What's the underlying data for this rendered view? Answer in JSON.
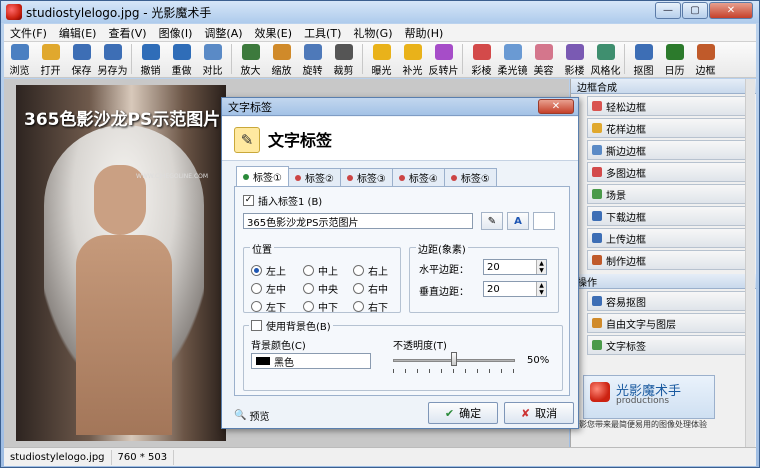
{
  "window": {
    "title": "studiostylelogo.jpg - 光影魔术手",
    "controls": {
      "minimize": "—",
      "maximize": "▢",
      "close": "✕"
    }
  },
  "menu": [
    "文件(F)",
    "编辑(E)",
    "查看(V)",
    "图像(I)",
    "调整(A)",
    "效果(E)",
    "工具(T)",
    "礼物(G)",
    "帮助(H)"
  ],
  "toolbar": [
    {
      "label": "浏览",
      "icon": "browse-icon",
      "color": "#4a7fc1"
    },
    {
      "label": "打开",
      "icon": "open-folder-icon",
      "color": "#e0a82e"
    },
    {
      "label": "保存",
      "icon": "save-icon",
      "color": "#3d6eb5"
    },
    {
      "label": "另存为",
      "icon": "save-as-icon",
      "color": "#3d6eb5"
    },
    {
      "label": "撤销",
      "icon": "undo-icon",
      "color": "#2f6db8"
    },
    {
      "label": "重做",
      "icon": "redo-icon",
      "color": "#2f6db8"
    },
    {
      "label": "对比",
      "icon": "compare-icon",
      "color": "#5a8ac6"
    },
    {
      "label": "放大",
      "icon": "zoom-in-icon",
      "color": "#3d7a3d"
    },
    {
      "label": "缩放",
      "icon": "resize-icon",
      "color": "#d08a2a"
    },
    {
      "label": "旋转",
      "icon": "rotate-icon",
      "color": "#4e79b9"
    },
    {
      "label": "裁剪",
      "icon": "crop-icon",
      "color": "#555555"
    },
    {
      "label": "曝光",
      "icon": "exposure-icon",
      "color": "#e9b21a"
    },
    {
      "label": "补光",
      "icon": "fill-light-icon",
      "color": "#e9b21a"
    },
    {
      "label": "反转片",
      "icon": "reversal-film-icon",
      "color": "#a64dc8"
    },
    {
      "label": "彩棱",
      "icon": "color-prism-icon",
      "color": "#d34a4a"
    },
    {
      "label": "柔光镜",
      "icon": "soft-focus-icon",
      "color": "#6a9ad3"
    },
    {
      "label": "美容",
      "icon": "beauty-icon",
      "color": "#d4768c"
    },
    {
      "label": "影楼",
      "icon": "studio-icon",
      "color": "#7a5ab3"
    },
    {
      "label": "风格化",
      "icon": "stylize-icon",
      "color": "#3f8f6f"
    },
    {
      "label": "抠图",
      "icon": "cutout-icon",
      "color": "#3d6eb5"
    },
    {
      "label": "日历",
      "icon": "calendar-icon",
      "color": "#2c7a2c"
    },
    {
      "label": "边框",
      "icon": "border-icon",
      "color": "#c05a2a"
    }
  ],
  "photo": {
    "overlay_text": "365色影沙龙PS示范图片",
    "watermark": "WWW.CJHEGOLINE.COM"
  },
  "right_panel": {
    "section1": "边框合成",
    "items1": [
      "轻松边框",
      "花样边框",
      "撕边边框",
      "多图边框",
      "场景",
      "下载边框",
      "上传边框",
      "制作边框"
    ],
    "section2": "操作",
    "items2": [
      "容易抠图",
      "自由文字与图层",
      "文字标签"
    ],
    "brand": "光影魔术手",
    "brand_sub": "productions",
    "tagline": "影您带来最简便易用的图像处理体验"
  },
  "status": {
    "filename": "studiostylelogo.jpg",
    "size": "760 * 503"
  },
  "dialog": {
    "window_title": "文字标签",
    "close": "✕",
    "heading": "文字标签",
    "tabs": [
      "标签①",
      "标签②",
      "标签③",
      "标签④",
      "标签⑤"
    ],
    "insert_label": "插入标签1 (B)",
    "label_text": "365色影沙龙PS示范图片",
    "position_title": "位置",
    "positions": [
      "左上",
      "中上",
      "右上",
      "左中",
      "中央",
      "右中",
      "左下",
      "中下",
      "右下"
    ],
    "margin_title": "边距(象素)",
    "h_margin_label": "水平边距：",
    "h_margin_value": "20",
    "v_margin_label": "垂直边距：",
    "v_margin_value": "20",
    "bg_color_check": "使用背景色(B)",
    "bg_color_label": "背景颜色(C)",
    "bg_color_value": "黑色",
    "opacity_label": "不透明度(T)",
    "opacity_value": "50%",
    "opacity_fraction": 0.5,
    "preview": "预览",
    "ok": "确定",
    "cancel": "取消"
  }
}
